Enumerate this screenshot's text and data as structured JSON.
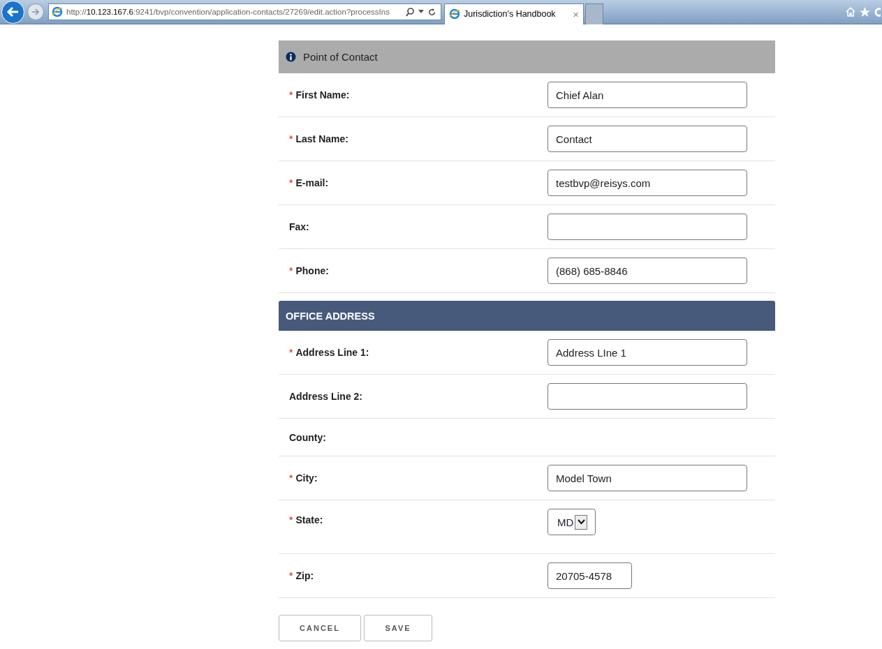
{
  "browser": {
    "address_host": "10.123.167.6",
    "address_prefix": "http://",
    "address_rest": ":9241/bvp/convention/application-contacts/27269/edit.action?processIns",
    "tab_title": "Jurisdiction's Handbook",
    "tab_close": "×"
  },
  "contact_section": {
    "title": "Point of Contact",
    "fields": [
      {
        "label": "First Name:",
        "required": true,
        "kind": "text",
        "value": "Chief Alan"
      },
      {
        "label": "Last Name:",
        "required": true,
        "kind": "text",
        "value": "Contact"
      },
      {
        "label": "E-mail:",
        "required": true,
        "kind": "text",
        "value": "testbvp@reisys.com"
      },
      {
        "label": "Fax:",
        "required": false,
        "kind": "text"
      },
      {
        "label": "Phone:",
        "required": true,
        "kind": "text",
        "value": "(868) 685-8846"
      }
    ]
  },
  "address_section": {
    "title": "OFFICE ADDRESS",
    "fields": [
      {
        "label": "Address Line 1:",
        "required": true,
        "kind": "text",
        "value": "Address LIne 1"
      },
      {
        "label": "Address Line 2:",
        "required": false,
        "kind": "text"
      },
      {
        "label": "County:",
        "required": false,
        "kind": "none"
      },
      {
        "label": "City:",
        "required": true,
        "kind": "text",
        "value": "Model Town"
      },
      {
        "label": "State:",
        "required": true,
        "kind": "select",
        "value": "MD"
      },
      {
        "label": "Zip:",
        "required": true,
        "kind": "short",
        "value": "20705-4578"
      }
    ]
  },
  "required_mark": "*",
  "buttons": [
    "CANCEL",
    "SAVE"
  ]
}
